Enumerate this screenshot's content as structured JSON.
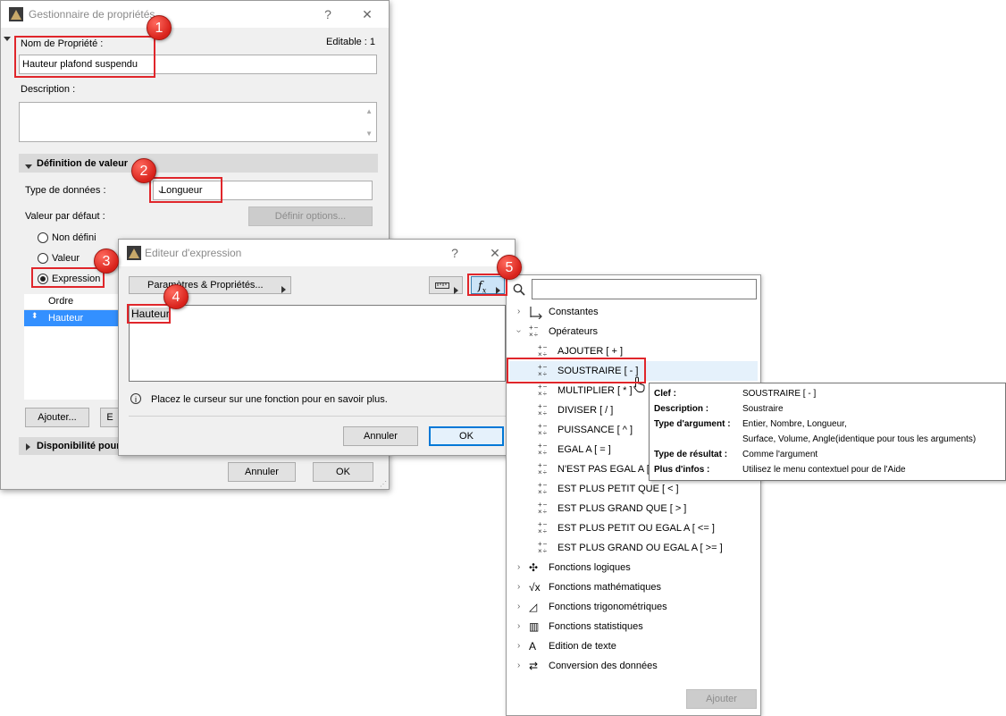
{
  "property_manager": {
    "title": "Gestionnaire de propriétés",
    "help": "?",
    "close": "✕",
    "name_label": "Nom de Propriété :",
    "editable": "Editable : 1",
    "name_value": "Hauteur plafond suspendu",
    "description_label": "Description :",
    "value_def_header": "Définition de valeur",
    "data_type_label": "Type de données :",
    "data_type_value": "Longueur",
    "default_value_label": "Valeur par défaut :",
    "define_options": "Définir options...",
    "radio_undefined": "Non défini",
    "radio_value": "Valeur",
    "radio_expression": "Expression",
    "order_header": "Ordre",
    "order_row": "Hauteur",
    "add_button": "Ajouter...",
    "edit_button_partial": "E",
    "availability_header": "Disponibilité pour",
    "cancel": "Annuler",
    "ok": "OK"
  },
  "expression_editor": {
    "title": "Editeur d'expression",
    "help": "?",
    "close": "✕",
    "params_button": "Paramètres & Propriétés...",
    "expression_text": "Hauteur",
    "hint": "Placez le curseur sur une fonction pour en savoir plus.",
    "cancel": "Annuler",
    "ok": "OK"
  },
  "function_panel": {
    "search_placeholder": "",
    "constants": "Constantes",
    "operators": "Opérateurs",
    "operator_items": [
      "AJOUTER  [ + ]",
      "SOUSTRAIRE  [ - ]",
      "MULTIPLIER  [ * ]",
      "DIVISER  [ / ]",
      "PUISSANCE  [ ^ ]",
      "EGAL A  [ = ]",
      "N'EST PAS EGAL A  [ <",
      "EST PLUS PETIT QUE  [ < ]",
      "EST PLUS GRAND QUE  [ > ]",
      "EST PLUS PETIT OU EGAL A  [ <= ]",
      "EST PLUS GRAND OU EGAL A  [ >= ]"
    ],
    "categories": [
      "Fonctions logiques",
      "Fonctions mathématiques",
      "Fonctions trigonométriques",
      "Fonctions statistiques",
      "Edition de texte",
      "Conversion des données"
    ],
    "add_button": "Ajouter"
  },
  "tooltip": {
    "key_label": "Clef :",
    "key_value": "SOUSTRAIRE  [ - ]",
    "desc_label": "Description :",
    "desc_value": "Soustraire",
    "argtype_label": "Type d'argument :",
    "argtype_value1": "Entier, Nombre, Longueur,",
    "argtype_value2": "Surface, Volume, Angle(identique pour tous les arguments)",
    "result_label": "Type de résultat :",
    "result_value": "Comme l'argument",
    "more_label": "Plus d'infos :",
    "more_value": "Utilisez le menu contextuel pour de l'Aide"
  },
  "badges": [
    "1",
    "2",
    "3",
    "4",
    "5"
  ],
  "colors": {
    "annotation_red": "#e0262b",
    "selection_blue": "#3390ff",
    "hover_blue": "#e5f1fb"
  }
}
